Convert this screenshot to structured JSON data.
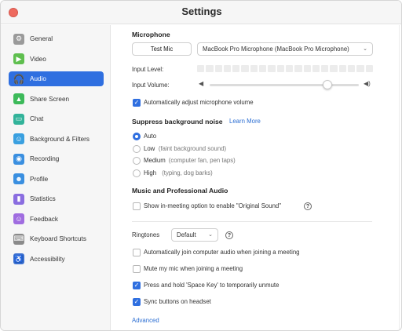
{
  "window": {
    "title": "Settings"
  },
  "sidebar": {
    "items": [
      {
        "label": "General",
        "icon": "gear-icon",
        "glyph": "⚙",
        "color": "#9a9a9a",
        "active": false
      },
      {
        "label": "Video",
        "icon": "video-icon",
        "glyph": "▶",
        "color": "#5fbf4f",
        "active": false
      },
      {
        "label": "Audio",
        "icon": "headphones-icon",
        "glyph": "🎧",
        "color": "#2f6fe0",
        "active": true
      },
      {
        "label": "Share Screen",
        "icon": "share-screen-icon",
        "glyph": "▲",
        "color": "#3dba5a",
        "active": false
      },
      {
        "label": "Chat",
        "icon": "chat-icon",
        "glyph": "▭",
        "color": "#32b39a",
        "active": false
      },
      {
        "label": "Background & Filters",
        "icon": "person-icon",
        "glyph": "☺",
        "color": "#3aa0e0",
        "active": false
      },
      {
        "label": "Recording",
        "icon": "recording-icon",
        "glyph": "◉",
        "color": "#3a8fe0",
        "active": false
      },
      {
        "label": "Profile",
        "icon": "profile-icon",
        "glyph": "☻",
        "color": "#3a8fe0",
        "active": false
      },
      {
        "label": "Statistics",
        "icon": "statistics-icon",
        "glyph": "▮",
        "color": "#8a6de0",
        "active": false
      },
      {
        "label": "Feedback",
        "icon": "feedback-icon",
        "glyph": "☺",
        "color": "#a06de0",
        "active": false
      },
      {
        "label": "Keyboard Shortcuts",
        "icon": "keyboard-icon",
        "glyph": "⌨",
        "color": "#8a8a8a",
        "active": false
      },
      {
        "label": "Accessibility",
        "icon": "accessibility-icon",
        "glyph": "♿",
        "color": "#3a6fd0",
        "active": false
      }
    ]
  },
  "microphone": {
    "title": "Microphone",
    "test_button": "Test Mic",
    "device": "MacBook Pro Microphone (MacBook Pro Microphone)",
    "input_level_label": "Input Level:",
    "input_volume_label": "Input Volume:",
    "volume_fraction": 0.79,
    "auto_adjust_label": "Automatically adjust microphone volume",
    "auto_adjust_checked": true
  },
  "noise": {
    "title": "Suppress background noise",
    "learn_more": "Learn More",
    "options": [
      {
        "label": "Auto",
        "hint": "",
        "selected": true
      },
      {
        "label": "Low",
        "hint": "(faint background sound)",
        "selected": false
      },
      {
        "label": "Medium",
        "hint": "(computer fan, pen taps)",
        "selected": false
      },
      {
        "label": "High",
        "hint": "(typing, dog barks)",
        "selected": false
      }
    ]
  },
  "music": {
    "title": "Music and Professional Audio",
    "original_sound_label": "Show in-meeting option to enable \"Original Sound\"",
    "original_sound_checked": false
  },
  "ringtones": {
    "label": "Ringtones",
    "value": "Default"
  },
  "options": {
    "auto_join": {
      "label": "Automatically join computer audio when joining a meeting",
      "checked": false
    },
    "mute_mic": {
      "label": "Mute my mic when joining a meeting",
      "checked": false
    },
    "space_key": {
      "label": "Press and hold 'Space Key' to temporarily unmute",
      "checked": true
    },
    "sync_headset": {
      "label": "Sync buttons on headset",
      "checked": true
    }
  },
  "advanced_link": "Advanced",
  "colors": {
    "accent": "#2f6fe0",
    "link": "#2d6fd3",
    "close": "#ee6a5f"
  }
}
